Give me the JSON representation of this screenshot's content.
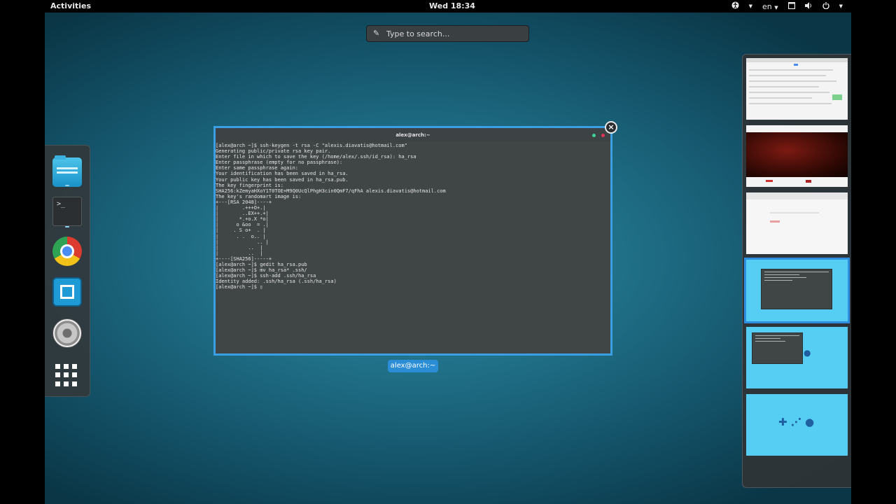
{
  "topbar": {
    "activities": "Activities",
    "clock": "Wed 18:34",
    "language": "en",
    "icons": [
      "accessibility-icon",
      "chevron-down-icon",
      "keyboard-layout",
      "window-icon",
      "volume-icon",
      "power-icon"
    ]
  },
  "search": {
    "placeholder": "Type to search...",
    "icon": "pencil-icon"
  },
  "dash": {
    "apps": [
      {
        "name": "files",
        "icon": "folder-icon",
        "running": true
      },
      {
        "name": "terminal",
        "icon": "terminal-icon",
        "running": true,
        "glyph": ">_"
      },
      {
        "name": "chrome",
        "icon": "chrome-icon",
        "running": false
      },
      {
        "name": "brackets",
        "icon": "brackets-icon",
        "running": false
      },
      {
        "name": "cheese",
        "icon": "camera-icon",
        "running": false
      },
      {
        "name": "show-applications",
        "icon": "app-grid-icon",
        "running": false
      }
    ]
  },
  "window": {
    "title": "alex@arch:~",
    "caption": "alex@arch:~",
    "close": "×",
    "terminal_text": "[alex@arch ~]$ ssh-keygen -t rsa -C \"alexis.diavatis@hotmail.com\"\nGenerating public/private rsa key pair.\nEnter file in which to save the key (/home/alex/.ssh/id_rsa): ha_rsa\nEnter passphrase (empty for no passphrase):\nEnter same passphrase again:\nYour identification has been saved in ha_rsa.\nYour public key has been saved in ha_rsa.pub.\nThe key fingerprint is:\nSHA256:kZemyaHXoY1T0TOE+M9Q0UcQlPhgH3cin0QmF7/qFhA alexis.diavatis@hotmail.com\nThe key's randomart image is:\n+---[RSA 2048]----+\n|        .+++O+.|\n|        ..EX++.+|\n|       *.+o.X *o|\n|      o &oo  = .|\n|     . S o+  . |\n|      . .  o.. |\n|             .. |\n|          ..  |\n|          ..  |\n+----[SHA256]-----+\n[alex@arch ~]$ gedit ha_rsa.pub\n[alex@arch ~]$ mv ha_rsa* .ssh/\n[alex@arch ~]$ ssh-add .ssh/ha_rsa\nIdentity added: .ssh/ha_rsa (.ssh/ha_rsa)\n[alex@arch ~]$ ▯",
    "accent": "#3aa0e3"
  },
  "workspaces": {
    "count": 6,
    "active_index": 3,
    "accent": "#56cdf2"
  }
}
